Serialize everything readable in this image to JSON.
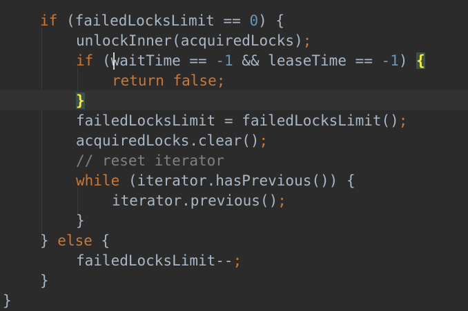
{
  "editor": {
    "lines": [
      {
        "tokens": [
          {
            "t": "if",
            "c": "kw"
          },
          {
            "t": " (failedLocksLimit == "
          },
          {
            "t": "0",
            "c": "num"
          },
          {
            "t": ") {"
          }
        ]
      },
      {
        "tokens": [
          {
            "t": "unlockInner(acquiredLocks)"
          },
          {
            "t": ";",
            "c": "kw"
          }
        ]
      },
      {
        "tokens": [
          {
            "t": "if",
            "c": "kw"
          },
          {
            "t": " ("
          },
          {
            "t": "waitTime == "
          },
          {
            "t": "-1",
            "c": "num"
          },
          {
            "t": " && leaseTime == "
          },
          {
            "t": "-1",
            "c": "num"
          },
          {
            "t": ") "
          },
          {
            "t": "{",
            "c": "brace"
          }
        ]
      },
      {
        "tokens": [
          {
            "t": "return false",
            "c": "kw"
          },
          {
            "t": ";",
            "c": "kw"
          }
        ]
      },
      {
        "tokens": [
          {
            "t": "}",
            "c": "brace"
          }
        ]
      },
      {
        "tokens": [
          {
            "t": "failedLocksLimit = failedLocksLimit()"
          },
          {
            "t": ";",
            "c": "kw"
          }
        ]
      },
      {
        "tokens": [
          {
            "t": "acquiredLocks.clear()"
          },
          {
            "t": ";",
            "c": "kw"
          }
        ]
      },
      {
        "tokens": [
          {
            "t": "// reset iterator",
            "c": "cm"
          }
        ]
      },
      {
        "tokens": [
          {
            "t": "while",
            "c": "kw"
          },
          {
            "t": " (iterator.hasPrevious()) {"
          }
        ]
      },
      {
        "tokens": [
          {
            "t": "iterator.previous()"
          },
          {
            "t": ";",
            "c": "kw"
          }
        ]
      },
      {
        "tokens": [
          {
            "t": "}"
          }
        ]
      },
      {
        "tokens": [
          {
            "t": "} "
          },
          {
            "t": "else",
            "c": "kw"
          },
          {
            "t": " {"
          }
        ]
      },
      {
        "tokens": [
          {
            "t": "failedLocksLimit--"
          },
          {
            "t": ";",
            "c": "kw"
          }
        ]
      },
      {
        "tokens": [
          {
            "t": "}"
          }
        ]
      },
      {
        "tokens": [
          {
            "t": "}"
          }
        ]
      }
    ]
  }
}
